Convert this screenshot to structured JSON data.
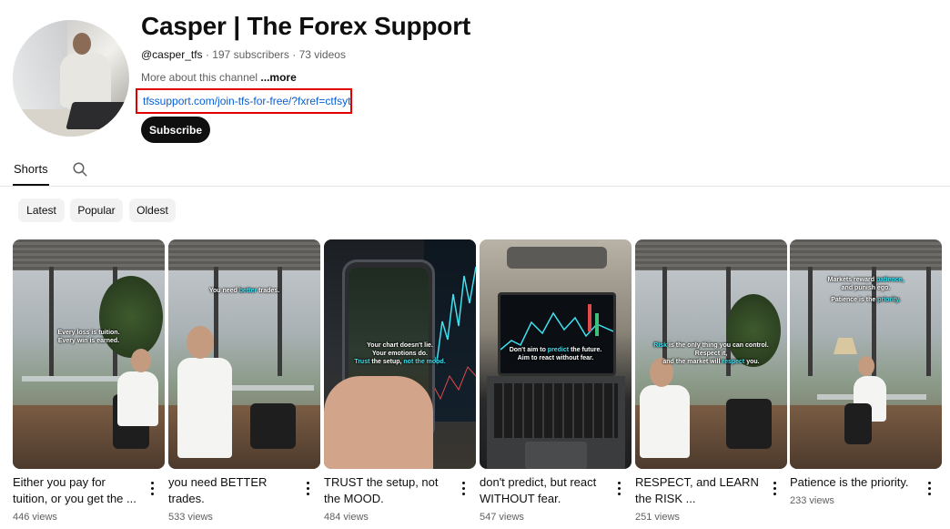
{
  "channel": {
    "name": "Casper | The Forex Support",
    "handle": "@casper_tfs",
    "stats": " · 197 subscribers · 73 videos",
    "about_prefix": "More about this channel ",
    "about_more": "...more",
    "link": "tfssupport.com/join-tfs-for-free/?fxref=ctfsyt",
    "subscribe_label": "Subscribe"
  },
  "tabs": {
    "active_label": "Shorts"
  },
  "filters": [
    "Latest",
    "Popular",
    "Oldest"
  ],
  "shorts": [
    {
      "title": "Either you pay for tuition, or you get the ...",
      "views": "446 views",
      "overlay_plain_1": "Every loss is tuition.",
      "overlay_plain_2": "Every win is earned."
    },
    {
      "title": "you need BETTER trades.",
      "views": "533 views",
      "overlay_plain_1": "You need ",
      "overlay_hl": "better",
      "overlay_plain_2": " trades."
    },
    {
      "title": "TRUST the setup, not the MOOD.",
      "views": "484 views",
      "overlay_plain_1": "Your chart doesn't lie.",
      "overlay_plain_2": "Your emotions do.",
      "overlay_hl": "Trust",
      "overlay_plain_3": " the setup, ",
      "overlay_hl_2": "not the mood."
    },
    {
      "title": "don't predict, but react WITHOUT fear.",
      "views": "547 views",
      "overlay_plain_1": "Don't aim to ",
      "overlay_hl": "predict",
      "overlay_plain_2": " the future.",
      "overlay_plain_3": "Aim to react without fear."
    },
    {
      "title": "RESPECT, and LEARN the RISK ...",
      "views": "251 views",
      "overlay_hl": "Risk",
      "overlay_plain_1": " is the only thing you can control.",
      "overlay_plain_2": "Respect it,",
      "overlay_plain_3": "and the market will ",
      "overlay_hl_2": "respect",
      "overlay_plain_4": " you."
    },
    {
      "title": "Patience is the priority.",
      "views": "233 views",
      "overlay_plain_1": "Markets reward ",
      "overlay_hl": "patience,",
      "overlay_plain_2": "and punish ego.",
      "overlay_plain_3": "Patience is the ",
      "overlay_hl_2": "priority."
    }
  ],
  "icons": {
    "search": "search-icon",
    "more": "more-vert-icon"
  },
  "colors": {
    "link": "#065fd4",
    "highlight_box": "#e00000",
    "subscribe_bg": "#0f0f0f",
    "overlay_highlight": "#3ee0f0"
  }
}
